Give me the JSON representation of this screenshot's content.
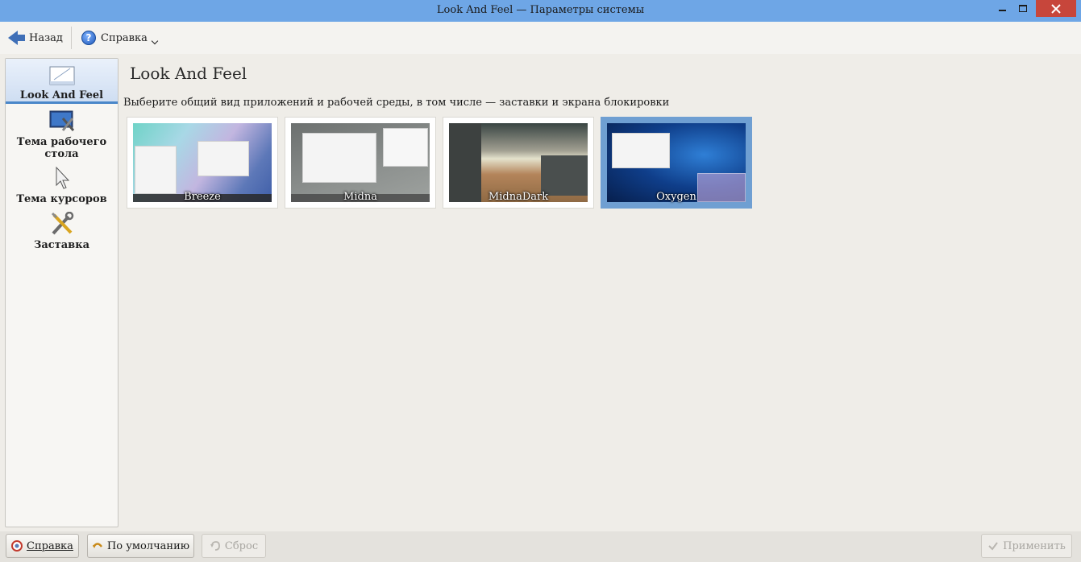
{
  "window": {
    "title": "Look And Feel — Параметры системы"
  },
  "toolbar": {
    "back_label": "Назад",
    "help_label": "Справка"
  },
  "sidebar": {
    "items": [
      {
        "label": "Look And Feel",
        "icon": "look-and-feel-icon",
        "selected": true
      },
      {
        "label": "Тема рабочего стола",
        "icon": "desktop-theme-icon",
        "selected": false
      },
      {
        "label": "Тема курсоров",
        "icon": "cursor-icon",
        "selected": false
      },
      {
        "label": "Заставка",
        "icon": "tools-icon",
        "selected": false
      }
    ]
  },
  "main": {
    "title": "Look And Feel",
    "description": "Выберите общий вид приложений и рабочей среды, в том числе — заставки и экрана блокировки",
    "themes": [
      {
        "name": "Breeze",
        "selected": false
      },
      {
        "name": "Midna",
        "selected": false
      },
      {
        "name": "MidnaDark",
        "selected": false
      },
      {
        "name": "Oxygen",
        "selected": true
      }
    ]
  },
  "footer": {
    "help_label": "Справка",
    "defaults_label": "По умолчанию",
    "reset_label": "Сброс",
    "apply_label": "Применить"
  },
  "colors": {
    "titlebar": "#6ea6e6",
    "close_button": "#c7463b",
    "selection": "#6f9fd2"
  }
}
